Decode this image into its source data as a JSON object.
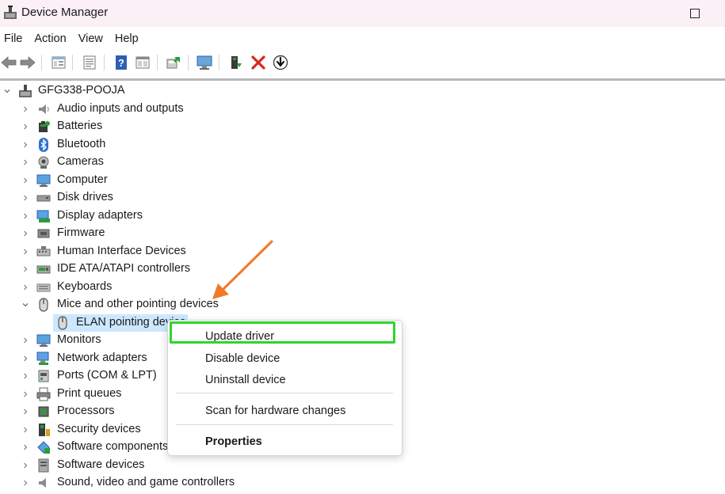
{
  "window": {
    "title": "Device Manager",
    "icons": {
      "app": "device-manager-icon",
      "maximize": "maximize-icon",
      "minimize": "minimize-icon"
    }
  },
  "menubar": {
    "items": [
      "File",
      "Action",
      "View",
      "Help"
    ]
  },
  "toolbar": {
    "icons": [
      "back-arrow-icon",
      "forward-arrow-icon",
      "properties-panel-icon",
      "list-view-icon",
      "help-icon",
      "details-view-icon",
      "update-driver-icon",
      "scan-hardware-icon",
      "enable-device-icon",
      "remove-device-icon",
      "download-driver-icon"
    ],
    "accent_red": "#d42a1e",
    "accent_blue": "#2e5fb3",
    "accent_green": "#2a9d3a"
  },
  "tree": {
    "root": "GFG338-POOJA",
    "categories": [
      {
        "label": "Audio inputs and outputs",
        "icon": "speaker-icon",
        "expanded": false
      },
      {
        "label": "Batteries",
        "icon": "battery-icon",
        "expanded": false
      },
      {
        "label": "Bluetooth",
        "icon": "bluetooth-icon",
        "expanded": false
      },
      {
        "label": "Cameras",
        "icon": "camera-icon",
        "expanded": false
      },
      {
        "label": "Computer",
        "icon": "computer-icon",
        "expanded": false
      },
      {
        "label": "Disk drives",
        "icon": "disk-drive-icon",
        "expanded": false
      },
      {
        "label": "Display adapters",
        "icon": "display-adapter-icon",
        "expanded": false
      },
      {
        "label": "Firmware",
        "icon": "firmware-icon",
        "expanded": false
      },
      {
        "label": "Human Interface Devices",
        "icon": "hid-icon",
        "expanded": false
      },
      {
        "label": "IDE ATA/ATAPI controllers",
        "icon": "ide-controller-icon",
        "expanded": false
      },
      {
        "label": "Keyboards",
        "icon": "keyboard-icon",
        "expanded": false
      },
      {
        "label": "Mice and other pointing devices",
        "icon": "mouse-icon",
        "expanded": true
      },
      {
        "label": "ELAN pointing device",
        "icon": "mouse-icon",
        "child": true,
        "selected": true
      },
      {
        "label": "Monitors",
        "icon": "monitor-icon",
        "expanded": false
      },
      {
        "label": "Network adapters",
        "icon": "network-adapter-icon",
        "expanded": false
      },
      {
        "label": "Ports (COM & LPT)",
        "icon": "port-icon",
        "expanded": false
      },
      {
        "label": "Print queues",
        "icon": "printer-icon",
        "expanded": false
      },
      {
        "label": "Processors",
        "icon": "processor-icon",
        "expanded": false
      },
      {
        "label": "Security devices",
        "icon": "security-device-icon",
        "expanded": false
      },
      {
        "label": "Software components",
        "icon": "software-component-icon",
        "expanded": false
      },
      {
        "label": "Software devices",
        "icon": "software-device-icon",
        "expanded": false
      },
      {
        "label": "Sound, video and game controllers",
        "icon": "sound-controller-icon",
        "expanded": false
      }
    ]
  },
  "context_menu": {
    "items": [
      {
        "label": "Update driver",
        "highlighted": true
      },
      {
        "label": "Disable device"
      },
      {
        "label": "Uninstall device"
      },
      {
        "label": "Scan for hardware changes"
      },
      {
        "label": "Properties",
        "bold": true
      }
    ],
    "highlight_color": "#2ed52e"
  },
  "annotation": {
    "arrow_color": "#f07a2a"
  }
}
